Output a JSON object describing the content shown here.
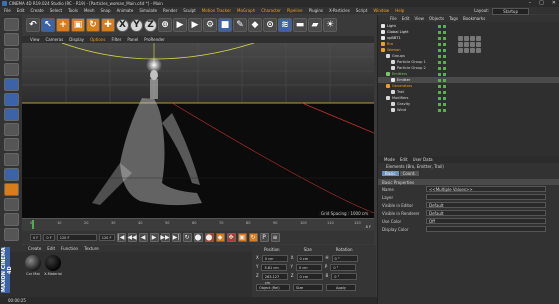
{
  "window": {
    "title": "CINEMA 4D R19.024 Studio (RC - R19) - [Particles_woman_Main.c4d *] - Main",
    "controls": [
      "–",
      "□",
      "✕"
    ]
  },
  "menubar": {
    "items": [
      "File",
      "Edit",
      "Create",
      "Select",
      "Tools",
      "Mesh",
      "Snap",
      "Animate",
      "Simulate",
      "Render",
      "Sculpt",
      "Motion Tracker",
      "MoGraph",
      "Character",
      "Pipeline",
      "Plugins",
      "X-Particles",
      "Script",
      "Window",
      "Help"
    ],
    "layout_label": "Layout:",
    "layout_value": "Startup"
  },
  "toolbar": {
    "buttons": [
      "",
      "",
      "+",
      "",
      "",
      "X",
      "Y",
      "Z",
      "",
      "",
      "",
      "",
      "",
      "",
      "",
      "",
      "",
      ""
    ]
  },
  "viewport": {
    "menu": [
      "View",
      "Cameras",
      "Display",
      "Options",
      "Filter",
      "Panel",
      "ProRender"
    ],
    "highlight_index": 3,
    "grid_readout": "Grid Spacing : 1000 cm"
  },
  "timeline": {
    "ticks": [
      "0",
      "10",
      "20",
      "30",
      "40",
      "50",
      "60",
      "70",
      "80",
      "90",
      "100",
      "110",
      "120"
    ],
    "current_frame": "8 F"
  },
  "transport": {
    "start": "0 F",
    "current": "0 F",
    "end": "120 F",
    "end2": "120 F",
    "buttons": [
      "|◀",
      "◀◀",
      "◀",
      "▶",
      "▶▶",
      "▶|",
      "↻"
    ]
  },
  "material_manager": {
    "menu": [
      "Create",
      "Edit",
      "Function",
      "Texture"
    ],
    "materials": [
      {
        "name": "Cor Mat"
      },
      {
        "name": "X-Material"
      }
    ]
  },
  "maxon_label": "MAXON CINEMA 4D",
  "coordinates": {
    "headers": [
      "Position",
      "Size",
      "Rotation"
    ],
    "rows": [
      [
        "X",
        "0 cm",
        "X",
        "0 cm",
        "H",
        "0 °"
      ],
      [
        "Y",
        "5.61 cm",
        "Y",
        "0 cm",
        "P",
        "0 °"
      ],
      [
        "Z",
        "263.127 cm",
        "Z",
        "0 cm",
        "B",
        "0 °"
      ]
    ],
    "mode1": "Object (Rel)",
    "mode2": "Size",
    "apply": "Apply"
  },
  "object_manager": {
    "menu": [
      "File",
      "Edit",
      "View",
      "Objects",
      "Tags",
      "Bookmarks"
    ],
    "objects": [
      {
        "name": "Light",
        "indent": 0,
        "color": "#e8e8e8",
        "selected": false
      },
      {
        "name": "Global Light",
        "indent": 0,
        "color": "#e8e8e8",
        "selected": false
      },
      {
        "name": "xpBBT1",
        "indent": 0,
        "color": "#e8e8e8",
        "selected": false
      },
      {
        "name": "Bro",
        "indent": 0,
        "color": "#f0a020",
        "selected": false
      },
      {
        "name": "Woman",
        "indent": 0,
        "color": "#f0a020",
        "selected": false
      },
      {
        "name": "Groups",
        "indent": 1,
        "color": "#d8d8d8",
        "selected": false
      },
      {
        "name": "Particle Group 1",
        "indent": 2,
        "color": "#d8d8d8",
        "selected": false
      },
      {
        "name": "Particle Group 2",
        "indent": 2,
        "color": "#d8d8d8",
        "selected": false
      },
      {
        "name": "Emitters",
        "indent": 1,
        "color": "#7ec46a",
        "selected": false
      },
      {
        "name": "Emitter",
        "indent": 2,
        "color": "#e8e8e8",
        "selected": true
      },
      {
        "name": "Generators",
        "indent": 1,
        "color": "#f0a020",
        "selected": false
      },
      {
        "name": "Trail",
        "indent": 2,
        "color": "#d8d8d8",
        "selected": false
      },
      {
        "name": "Modifiers",
        "indent": 1,
        "color": "#d8d8d8",
        "selected": false
      },
      {
        "name": "Gravity",
        "indent": 2,
        "color": "#d8d8d8",
        "selected": false
      },
      {
        "name": "Wind",
        "indent": 2,
        "color": "#d8d8d8",
        "selected": false
      }
    ]
  },
  "attribute_manager": {
    "menu": [
      "Mode",
      "Edit",
      "User Data"
    ],
    "title": "Elements (Bro, Emitter, Trail)",
    "tabs": [
      "Basic",
      "Coord."
    ],
    "section": "Basic Properties",
    "fields": [
      {
        "label": "Name",
        "value": "<<Multiple Values>>"
      },
      {
        "label": "Layer",
        "value": ""
      },
      {
        "label": "Visible in Editor",
        "value": "Default"
      },
      {
        "label": "Visible in Renderer",
        "value": "Default"
      },
      {
        "label": "Use Color",
        "value": "Off"
      },
      {
        "label": "Display Color",
        "value": ""
      }
    ]
  },
  "status": "00:00:25"
}
